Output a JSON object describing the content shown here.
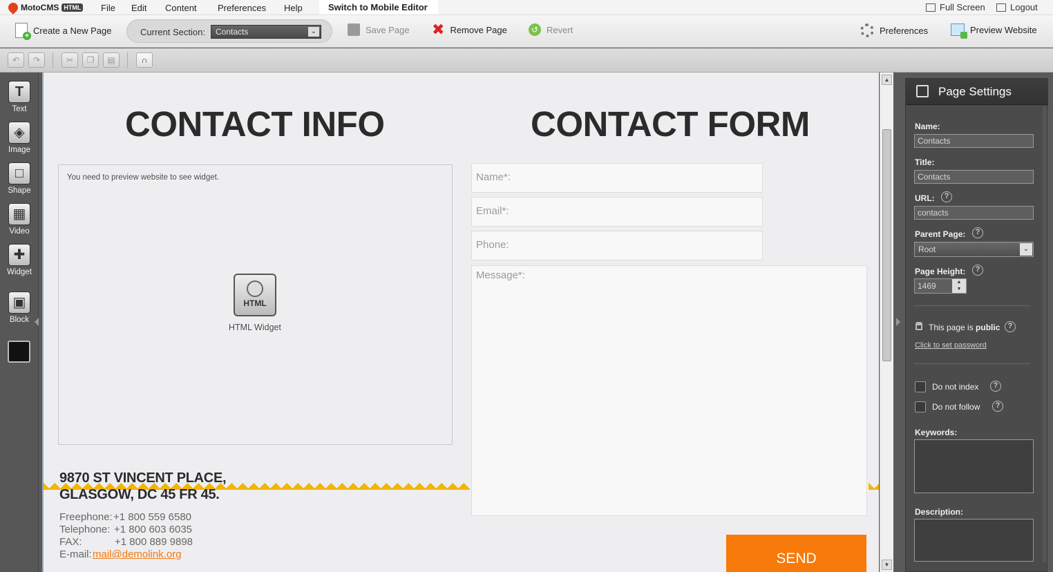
{
  "app": {
    "name": "MotoCMS",
    "badge": "HTML"
  },
  "menu": {
    "file": "File",
    "edit": "Edit",
    "content": "Content",
    "preferences": "Preferences",
    "help": "Help",
    "mobile_switch": "Switch to Mobile Editor",
    "full_screen": "Full Screen",
    "logout": "Logout"
  },
  "toolbar": {
    "create_page": "Create a New Page",
    "current_section_label": "Current Section:",
    "current_section_value": "Contacts",
    "save_page": "Save Page",
    "remove_page": "Remove Page",
    "revert": "Revert",
    "preferences": "Preferences",
    "preview_website": "Preview Website"
  },
  "edit_toolbar": {
    "icons": [
      "undo-icon",
      "redo-icon",
      "cut-icon",
      "copy-icon",
      "paste-icon",
      "magnet-icon"
    ]
  },
  "tools": [
    {
      "label": "Text",
      "icon": "text-icon",
      "glyph": "T"
    },
    {
      "label": "Image",
      "icon": "image-icon",
      "glyph": "◈"
    },
    {
      "label": "Shape",
      "icon": "shape-icon",
      "glyph": "□"
    },
    {
      "label": "Video",
      "icon": "video-icon",
      "glyph": "▦"
    },
    {
      "label": "Widget",
      "icon": "widget-icon",
      "glyph": "✚"
    },
    {
      "label": "Block",
      "icon": "block-icon",
      "glyph": "▣"
    }
  ],
  "canvas": {
    "heading_info": "CONTACT INFO",
    "heading_form": "CONTACT FORM",
    "widget_message": "You need to preview website to see widget.",
    "widget_label": "HTML Widget",
    "widget_icon_text": "HTML",
    "address_line1": "9870 ST VINCENT PLACE,",
    "address_line2": "GLASGOW, DC 45 FR 45.",
    "freephone_label": "Freephone:",
    "freephone_value": "+1 800 559 6580",
    "telephone_label": "Telephone:",
    "telephone_value": "+1 800 603 6035",
    "fax_label": "FAX:",
    "fax_value": "+1 800 889 9898",
    "email_label": "E-mail:",
    "email_value": "mail@demolink.org",
    "form": {
      "name_placeholder": "Name*:",
      "email_placeholder": "Email*:",
      "phone_placeholder": "Phone:",
      "message_placeholder": "Message*:",
      "send_label": "SEND"
    },
    "accent_color": "#f77a0a",
    "zigzag_color": "#f3b500"
  },
  "page_settings": {
    "title": "Page Settings",
    "name_label": "Name:",
    "name_value": "Contacts",
    "title_label": "Title:",
    "title_value": "Contacts",
    "url_label": "URL:",
    "url_value": "contacts",
    "parent_label": "Parent Page:",
    "parent_value": "Root",
    "height_label": "Page Height:",
    "height_value": "1469",
    "public_prefix": "This page is",
    "public_word": "public",
    "set_password_link": "Click to set password",
    "no_index_label": "Do not index",
    "no_follow_label": "Do not follow",
    "keywords_label": "Keywords:",
    "description_label": "Description:"
  }
}
